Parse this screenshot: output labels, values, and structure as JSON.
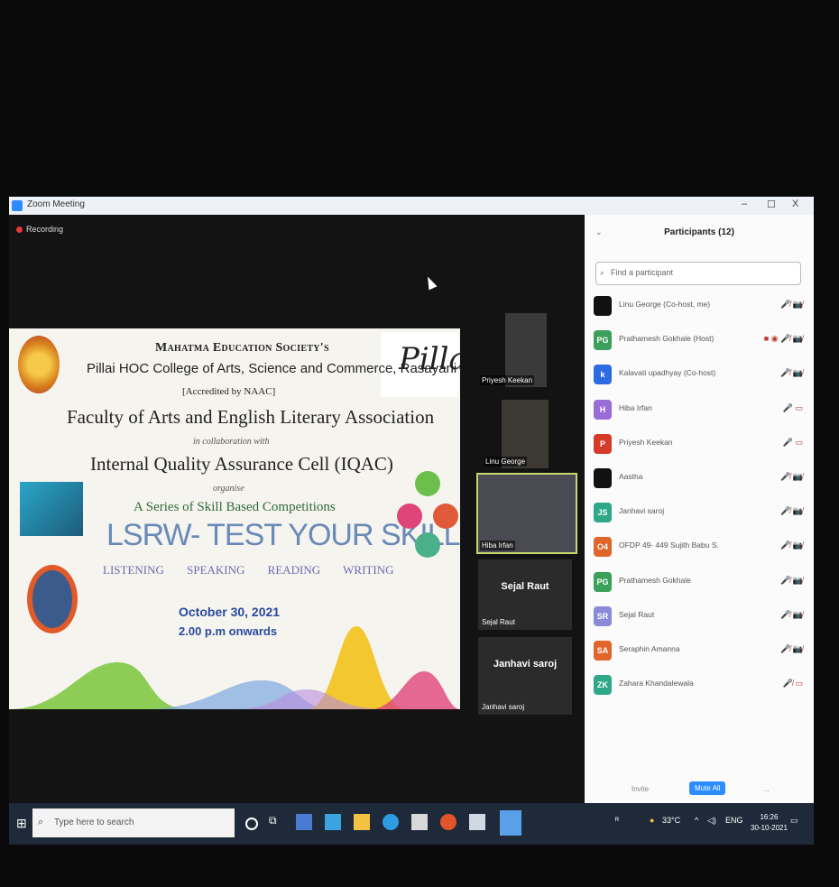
{
  "window": {
    "title": "Zoom Meeting",
    "controls": [
      "–",
      "☐",
      "X"
    ]
  },
  "meeting": {
    "recording_label": "Recording"
  },
  "slide": {
    "line1": "Mahatma Education Society's",
    "line2": "Pillai HOC College of Arts, Science and Commerce, Rasayani",
    "line3": "[Accredited by NAAC]",
    "line4": "Faculty of Arts and English Literary Association",
    "line5": "in collaboration with",
    "line6": "Internal Quality Assurance Cell (IQAC)",
    "line7": "organise",
    "line8": "A Series of  Skill Based Competitions",
    "line9": "LSRW- TEST YOUR SKILLS",
    "line10": "LISTENING   SPEAKING   READING   WRITING",
    "date": "October 30, 2021",
    "time": "2.00 p.m onwards",
    "signature": "Pillai"
  },
  "videos": [
    {
      "label": "Priyesh Keekan"
    },
    {
      "label": "Linu George"
    },
    {
      "label": "Hiba Irfan"
    }
  ],
  "tiles": [
    {
      "name": "Sejal Raut",
      "label": "Sejal Raut"
    },
    {
      "name": "Janhavi saroj",
      "label": "Janhavi saroj"
    }
  ],
  "participants_panel": {
    "header": "Participants (12)",
    "search_placeholder": "Find a participant",
    "items": [
      {
        "initials": "",
        "name": "Linu George (Co-host, me)",
        "color": "#111111",
        "icons": "🎤̸ 📷̸"
      },
      {
        "initials": "PG",
        "name": "Prathamesh Gokhale (Host)",
        "color": "#3aa05a",
        "icons": "■ ◉ 🎤̸ 📷̸"
      },
      {
        "initials": "k",
        "name": "Kalavati upadhyay (Co-host)",
        "color": "#2d6be0",
        "icons": "🎤̸ 📷̸"
      },
      {
        "initials": "H",
        "name": "Hiba Irfan",
        "color": "#9a6cd8",
        "icons": "🎤 ▭"
      },
      {
        "initials": "P",
        "name": "Priyesh Keekan",
        "color": "#d63a2a",
        "icons": "🎤 ▭"
      },
      {
        "initials": "",
        "name": "Aastha",
        "color": "#111111",
        "icons": "🎤̸ 📷̸"
      },
      {
        "initials": "JS",
        "name": "Janhavi saroj",
        "color": "#2fa88a",
        "icons": "🎤̸ 📷̸"
      },
      {
        "initials": "O4",
        "name": "OFDP 49- 449 Sujith Babu S.",
        "color": "#e0652a",
        "icons": "🎤̸ 📷̸"
      },
      {
        "initials": "PG",
        "name": "Prathamesh Gokhale",
        "color": "#3aa05a",
        "icons": "🎤̸ 📷̸"
      },
      {
        "initials": "SR",
        "name": "Sejal Raut",
        "color": "#8a8ad8",
        "icons": "🎤̸ 📷̸"
      },
      {
        "initials": "SA",
        "name": "Seraphin Amanna",
        "color": "#e0652a",
        "icons": "🎤̸ 📷̸"
      },
      {
        "initials": "ZK",
        "name": "Zahara Khandalewala",
        "color": "#2fa88a",
        "icons": "🎤̸ ▭"
      }
    ],
    "invite_label": "Invite",
    "mute_all_label": "Mute All",
    "more_label": "..."
  },
  "taskbar": {
    "search_placeholder": "Type here to search",
    "weather": "33°C",
    "language": "ENG",
    "time": "16:26",
    "date": "30-10-2021"
  }
}
